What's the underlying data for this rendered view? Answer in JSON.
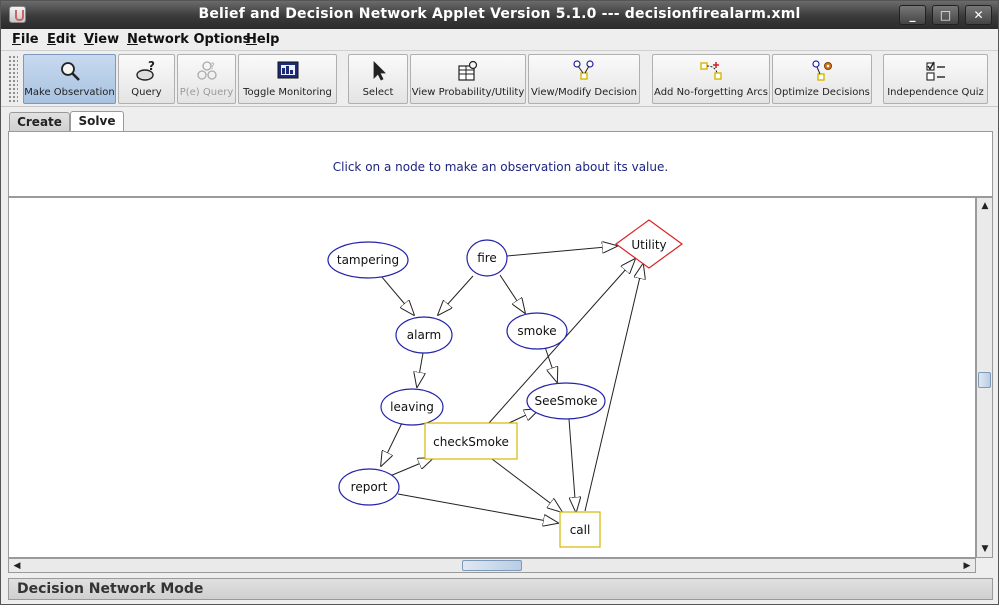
{
  "window": {
    "title": "Belief and Decision Network Applet Version 5.1.0 --- decisionfirealarm.xml",
    "controls": [
      "_",
      "□",
      "✕"
    ]
  },
  "menu": [
    {
      "first": "F",
      "rest": "ile"
    },
    {
      "first": "E",
      "rest": "dit"
    },
    {
      "first": "V",
      "rest": "iew"
    },
    {
      "first": "N",
      "rest": "etwork Options"
    },
    {
      "first": "H",
      "rest": "elp"
    }
  ],
  "toolbar": {
    "make_observation": "Make Observation",
    "query": "Query",
    "pe_query": "P(e) Query",
    "toggle_monitoring": "Toggle Monitoring",
    "select": "Select",
    "view_probability": "View Probability/Utility",
    "view_decision": "View/Modify Decision",
    "add_arcs": "Add No-forgetting Arcs",
    "optimize": "Optimize Decisions",
    "independence_quiz": "Independence Quiz"
  },
  "tabs": {
    "create": "Create",
    "solve": "Solve"
  },
  "message": "Click on a node to make an observation about its value.",
  "network": {
    "nodes": {
      "tampering": "tampering",
      "fire": "fire",
      "utility": "Utility",
      "alarm": "alarm",
      "smoke": "smoke",
      "leaving": "leaving",
      "seesmoke": "SeeSmoke",
      "checksmoke": "checkSmoke",
      "report": "report",
      "call": "call"
    },
    "colors": {
      "chance": "#2222aa",
      "decision": "#d4b800",
      "utility": "#dd2222"
    }
  },
  "status": "Decision Network Mode"
}
